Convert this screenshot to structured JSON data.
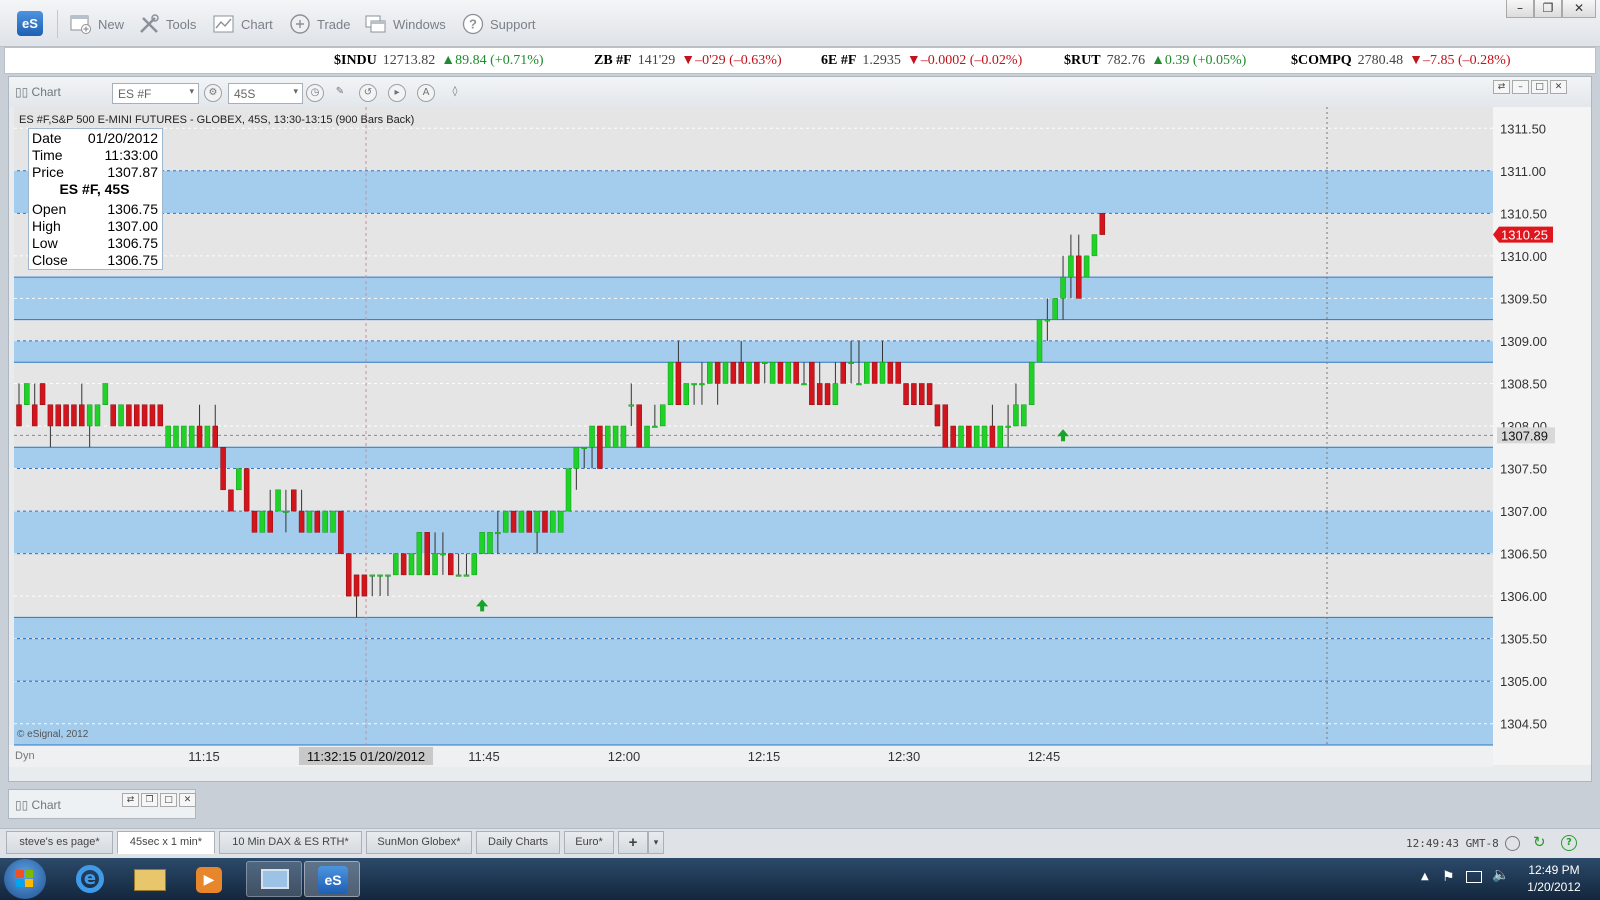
{
  "app": {
    "logo": "eS",
    "toolbar": [
      {
        "label": "New",
        "icon": "new-window-icon"
      },
      {
        "label": "Tools",
        "icon": "tools-icon"
      },
      {
        "label": "Chart",
        "icon": "chart-icon"
      },
      {
        "label": "Trade",
        "icon": "trade-icon"
      },
      {
        "label": "Windows",
        "icon": "windows-icon"
      },
      {
        "label": "Support",
        "icon": "support-icon"
      }
    ]
  },
  "ticker": [
    {
      "symbol": "$INDU",
      "last": "12713.82",
      "dir": "up",
      "change": "89.84 (+0.71%)"
    },
    {
      "symbol": "ZB #F",
      "last": "141'29",
      "dir": "down",
      "change": "–0'29 (–0.63%)"
    },
    {
      "symbol": "6E #F",
      "last": "1.2935",
      "dir": "down",
      "change": "–0.0002 (–0.02%)"
    },
    {
      "symbol": "$RUT",
      "last": "782.76",
      "dir": "up",
      "change": "0.39 (+0.05%)"
    },
    {
      "symbol": "$COMPQ",
      "last": "2780.48",
      "dir": "down",
      "change": "–7.85 (–0.28%)"
    }
  ],
  "chart_window": {
    "title": "Chart",
    "symbol_input": "ES #F",
    "interval_input": "45S",
    "header": "ES #F,S&P 500 E-MINI FUTURES - GLOBEX, 45S, 13:30-13:15 (900 Bars Back)",
    "copyright": "© eSignal, 2012",
    "dyn_label": "Dyn",
    "crosshair_label": "11:32:15 01/20/2012",
    "last_price_label": "1310.25",
    "cursor_price_label": "1307.89"
  },
  "data_window": {
    "date_label": "Date",
    "date": "01/20/2012",
    "time_label": "Time",
    "time": "11:33:00",
    "price_label": "Price",
    "price": "1307.87",
    "series": "ES #F, 45S",
    "open_label": "Open",
    "open": "1306.75",
    "high_label": "High",
    "high": "1307.00",
    "low_label": "Low",
    "low": "1306.75",
    "close_label": "Close",
    "close": "1306.75"
  },
  "chart_data": {
    "type": "candlestick",
    "y_axis_ticks": [
      "1311.50",
      "1311.00",
      "1310.50",
      "1310.00",
      "1309.50",
      "1309.00",
      "1308.50",
      "1308.00",
      "1307.50",
      "1307.00",
      "1306.50",
      "1306.00",
      "1305.50",
      "1305.00",
      "1304.50"
    ],
    "x_axis_ticks": [
      "11:15",
      "11:45",
      "12:00",
      "12:15",
      "12:30",
      "12:45"
    ],
    "ylim": [
      1304.25,
      1311.75
    ],
    "zones": [
      [
        1310.5,
        1311.0
      ],
      [
        1309.25,
        1309.75
      ],
      [
        1308.75,
        1309.0
      ],
      [
        1307.5,
        1307.75
      ],
      [
        1306.5,
        1307.0
      ],
      [
        1305.5,
        1305.75
      ],
      [
        1305.0,
        1305.5
      ],
      [
        1304.25,
        1305.0
      ]
    ],
    "candles": [
      [
        1308.25,
        1308.5,
        1308.0,
        1308.0
      ],
      [
        1308.25,
        1308.5,
        1308.25,
        1308.5
      ],
      [
        1308.25,
        1308.5,
        1308.0,
        1308.0
      ],
      [
        1308.5,
        1308.5,
        1308.25,
        1308.25
      ],
      [
        1308.25,
        1308.25,
        1307.75,
        1308.0
      ],
      [
        1308.25,
        1308.25,
        1308.0,
        1308.0
      ],
      [
        1308.25,
        1308.25,
        1308.0,
        1308.0
      ],
      [
        1308.25,
        1308.25,
        1308.0,
        1308.0
      ],
      [
        1308.25,
        1308.5,
        1308.0,
        1308.0
      ],
      [
        1308.0,
        1308.25,
        1307.75,
        1308.25
      ],
      [
        1308.0,
        1308.25,
        1308.0,
        1308.25
      ],
      [
        1308.25,
        1308.5,
        1308.25,
        1308.5
      ],
      [
        1308.25,
        1308.25,
        1308.0,
        1308.0
      ],
      [
        1308.0,
        1308.25,
        1308.0,
        1308.25
      ],
      [
        1308.25,
        1308.25,
        1308.0,
        1308.0
      ],
      [
        1308.25,
        1308.25,
        1308.0,
        1308.0
      ],
      [
        1308.25,
        1308.25,
        1308.0,
        1308.0
      ],
      [
        1308.25,
        1308.25,
        1308.0,
        1308.0
      ],
      [
        1308.25,
        1308.25,
        1308.0,
        1308.0
      ],
      [
        1307.75,
        1308.0,
        1307.75,
        1308.0
      ],
      [
        1307.75,
        1308.0,
        1307.75,
        1308.0
      ],
      [
        1307.75,
        1308.0,
        1307.75,
        1308.0
      ],
      [
        1307.75,
        1308.0,
        1307.75,
        1308.0
      ],
      [
        1308.0,
        1308.25,
        1307.75,
        1307.75
      ],
      [
        1307.75,
        1308.0,
        1307.75,
        1308.0
      ],
      [
        1308.0,
        1308.25,
        1307.75,
        1307.75
      ],
      [
        1307.75,
        1307.75,
        1307.25,
        1307.25
      ],
      [
        1307.25,
        1307.25,
        1307.0,
        1307.0
      ],
      [
        1307.25,
        1307.5,
        1307.25,
        1307.5
      ],
      [
        1307.5,
        1307.5,
        1307.0,
        1307.0
      ],
      [
        1307.0,
        1307.0,
        1306.75,
        1306.75
      ],
      [
        1306.75,
        1307.0,
        1306.75,
        1307.0
      ],
      [
        1307.0,
        1307.25,
        1306.75,
        1306.75
      ],
      [
        1307.0,
        1307.25,
        1307.0,
        1307.25
      ],
      [
        1307.0,
        1307.25,
        1306.75,
        1307.0
      ],
      [
        1307.25,
        1307.25,
        1307.0,
        1307.0
      ],
      [
        1307.0,
        1307.25,
        1306.75,
        1306.75
      ],
      [
        1306.75,
        1307.0,
        1306.75,
        1307.0
      ],
      [
        1307.0,
        1307.0,
        1306.75,
        1306.75
      ],
      [
        1306.75,
        1307.0,
        1306.75,
        1307.0
      ],
      [
        1306.75,
        1307.0,
        1306.75,
        1307.0
      ],
      [
        1307.0,
        1307.0,
        1306.5,
        1306.5
      ],
      [
        1306.5,
        1306.5,
        1306.0,
        1306.0
      ],
      [
        1306.25,
        1306.25,
        1305.75,
        1306.0
      ],
      [
        1306.25,
        1306.25,
        1306.0,
        1306.0
      ],
      [
        1306.25,
        1306.25,
        1306.0,
        1306.25
      ],
      [
        1306.25,
        1306.25,
        1306.0,
        1306.25
      ],
      [
        1306.25,
        1306.25,
        1306.0,
        1306.25
      ],
      [
        1306.25,
        1306.5,
        1306.25,
        1306.5
      ],
      [
        1306.5,
        1306.5,
        1306.25,
        1306.25
      ],
      [
        1306.25,
        1306.5,
        1306.25,
        1306.5
      ],
      [
        1306.25,
        1306.75,
        1306.25,
        1306.75
      ],
      [
        1306.75,
        1306.75,
        1306.25,
        1306.25
      ],
      [
        1306.25,
        1306.75,
        1306.25,
        1306.5
      ],
      [
        1306.5,
        1306.75,
        1306.25,
        1306.5
      ],
      [
        1306.5,
        1306.5,
        1306.25,
        1306.25
      ],
      [
        1306.25,
        1306.5,
        1306.25,
        1306.25
      ],
      [
        1306.25,
        1306.5,
        1306.25,
        1306.25
      ],
      [
        1306.25,
        1306.5,
        1306.25,
        1306.5
      ],
      [
        1306.5,
        1306.75,
        1306.5,
        1306.75
      ],
      [
        1306.5,
        1306.75,
        1306.5,
        1306.75
      ],
      [
        1306.75,
        1307.0,
        1306.5,
        1306.75
      ],
      [
        1306.75,
        1307.0,
        1306.75,
        1307.0
      ],
      [
        1307.0,
        1307.0,
        1306.75,
        1306.75
      ],
      [
        1306.75,
        1307.0,
        1306.75,
        1307.0
      ],
      [
        1307.0,
        1307.0,
        1306.75,
        1306.75
      ],
      [
        1306.75,
        1307.0,
        1306.5,
        1307.0
      ],
      [
        1307.0,
        1307.0,
        1306.75,
        1306.75
      ],
      [
        1306.75,
        1307.0,
        1306.75,
        1307.0
      ],
      [
        1306.75,
        1307.0,
        1306.75,
        1307.0
      ],
      [
        1307.0,
        1307.5,
        1307.0,
        1307.5
      ],
      [
        1307.5,
        1307.75,
        1307.25,
        1307.75
      ],
      [
        1307.75,
        1307.75,
        1307.5,
        1307.75
      ],
      [
        1307.75,
        1308.0,
        1307.5,
        1308.0
      ],
      [
        1308.0,
        1308.0,
        1307.5,
        1307.5
      ],
      [
        1307.75,
        1308.0,
        1307.75,
        1308.0
      ],
      [
        1307.75,
        1308.0,
        1307.75,
        1308.0
      ],
      [
        1307.75,
        1308.0,
        1307.75,
        1308.0
      ],
      [
        1308.25,
        1308.5,
        1308.0,
        1308.25
      ],
      [
        1308.25,
        1308.25,
        1307.75,
        1307.75
      ],
      [
        1307.75,
        1308.0,
        1307.75,
        1308.0
      ],
      [
        1308.0,
        1308.25,
        1308.0,
        1308.0
      ],
      [
        1308.0,
        1308.25,
        1308.0,
        1308.25
      ],
      [
        1308.25,
        1308.75,
        1308.25,
        1308.75
      ],
      [
        1308.75,
        1309.0,
        1308.25,
        1308.25
      ],
      [
        1308.25,
        1308.5,
        1308.25,
        1308.5
      ],
      [
        1308.5,
        1308.5,
        1308.25,
        1308.5
      ],
      [
        1308.5,
        1308.75,
        1308.25,
        1308.5
      ],
      [
        1308.5,
        1308.75,
        1308.5,
        1308.75
      ],
      [
        1308.75,
        1308.75,
        1308.25,
        1308.5
      ],
      [
        1308.5,
        1308.75,
        1308.5,
        1308.75
      ],
      [
        1308.75,
        1308.75,
        1308.5,
        1308.5
      ],
      [
        1308.75,
        1309.0,
        1308.5,
        1308.5
      ],
      [
        1308.5,
        1308.75,
        1308.5,
        1308.75
      ],
      [
        1308.75,
        1308.75,
        1308.5,
        1308.5
      ],
      [
        1308.75,
        1308.75,
        1308.5,
        1308.75
      ],
      [
        1308.5,
        1308.75,
        1308.5,
        1308.75
      ],
      [
        1308.75,
        1308.75,
        1308.5,
        1308.5
      ],
      [
        1308.5,
        1308.75,
        1308.5,
        1308.75
      ],
      [
        1308.75,
        1308.75,
        1308.5,
        1308.5
      ],
      [
        1308.5,
        1308.75,
        1308.5,
        1308.5
      ],
      [
        1308.75,
        1308.75,
        1308.25,
        1308.25
      ],
      [
        1308.5,
        1308.75,
        1308.25,
        1308.25
      ],
      [
        1308.5,
        1308.5,
        1308.25,
        1308.25
      ],
      [
        1308.25,
        1308.75,
        1308.25,
        1308.5
      ],
      [
        1308.75,
        1308.75,
        1308.5,
        1308.5
      ],
      [
        1308.75,
        1309.0,
        1308.5,
        1308.75
      ],
      [
        1308.5,
        1309.0,
        1308.5,
        1308.5
      ],
      [
        1308.5,
        1308.75,
        1308.5,
        1308.75
      ],
      [
        1308.75,
        1308.75,
        1308.5,
        1308.5
      ],
      [
        1308.5,
        1309.0,
        1308.5,
        1308.75
      ],
      [
        1308.75,
        1308.75,
        1308.5,
        1308.5
      ],
      [
        1308.75,
        1308.75,
        1308.5,
        1308.5
      ],
      [
        1308.5,
        1308.5,
        1308.25,
        1308.25
      ],
      [
        1308.5,
        1308.5,
        1308.25,
        1308.25
      ],
      [
        1308.5,
        1308.5,
        1308.25,
        1308.25
      ],
      [
        1308.5,
        1308.5,
        1308.25,
        1308.25
      ],
      [
        1308.25,
        1308.25,
        1308.0,
        1308.0
      ],
      [
        1308.25,
        1308.25,
        1307.75,
        1307.75
      ],
      [
        1308.0,
        1308.0,
        1307.75,
        1307.75
      ],
      [
        1307.75,
        1308.0,
        1307.75,
        1308.0
      ],
      [
        1308.0,
        1308.0,
        1307.75,
        1307.75
      ],
      [
        1307.75,
        1308.0,
        1307.75,
        1308.0
      ],
      [
        1307.75,
        1308.0,
        1307.75,
        1308.0
      ],
      [
        1308.0,
        1308.25,
        1307.75,
        1307.75
      ],
      [
        1307.75,
        1308.0,
        1307.75,
        1308.0
      ],
      [
        1308.0,
        1308.25,
        1307.75,
        1308.0
      ],
      [
        1308.0,
        1308.5,
        1308.0,
        1308.25
      ],
      [
        1308.0,
        1308.25,
        1308.0,
        1308.25
      ],
      [
        1308.25,
        1308.75,
        1308.25,
        1308.75
      ],
      [
        1308.75,
        1309.25,
        1308.75,
        1309.25
      ],
      [
        1309.25,
        1309.5,
        1309.0,
        1309.25
      ],
      [
        1309.25,
        1309.5,
        1309.25,
        1309.5
      ],
      [
        1309.5,
        1310.0,
        1309.25,
        1309.75
      ],
      [
        1309.75,
        1310.25,
        1309.5,
        1310.0
      ],
      [
        1310.0,
        1310.25,
        1309.5,
        1309.5
      ],
      [
        1309.75,
        1310.0,
        1309.75,
        1310.0
      ],
      [
        1310.0,
        1310.25,
        1310.0,
        1310.25
      ],
      [
        1310.5,
        1310.5,
        1310.25,
        1310.25
      ]
    ],
    "markers": [
      {
        "type": "up-arrow",
        "index": 59,
        "price": 1305.88
      },
      {
        "type": "up-arrow",
        "index": 133,
        "price": 1307.88
      }
    ]
  },
  "bottom": {
    "mini_chart_title": "Chart",
    "tabs": [
      {
        "label": "steve's es page*",
        "active": false
      },
      {
        "label": "45sec x 1 min*",
        "active": true
      },
      {
        "label": "10 Min DAX & ES RTH*",
        "active": false
      },
      {
        "label": "SunMon Globex*",
        "active": false
      },
      {
        "label": "Daily Charts",
        "active": false
      },
      {
        "label": "Euro*",
        "active": false
      }
    ],
    "clock": "12:49:43 GMT-8"
  },
  "taskbar": {
    "time": "12:49 PM",
    "date": "1/20/2012"
  }
}
